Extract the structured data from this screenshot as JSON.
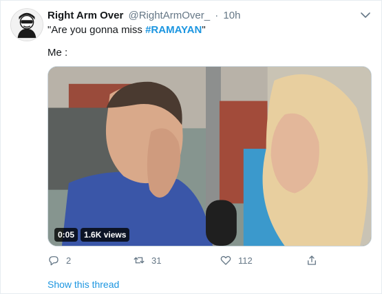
{
  "tweet": {
    "display_name": "Right Arm Over",
    "handle": "@RightArmOver_",
    "separator": "·",
    "time": "10h",
    "text_before_hashtag": "\"Are you gonna miss ",
    "hashtag": "#RAMAYAN",
    "text_after_hashtag": "\"",
    "second_line": "Me :"
  },
  "video": {
    "duration": "0:05",
    "views": "1.6K views"
  },
  "actions": {
    "reply_count": "2",
    "retweet_count": "31",
    "like_count": "112"
  },
  "show_thread": "Show this thread",
  "colors": {
    "link_blue": "#1b95e0",
    "secondary_text": "#657786",
    "border": "#e6ecf0"
  }
}
